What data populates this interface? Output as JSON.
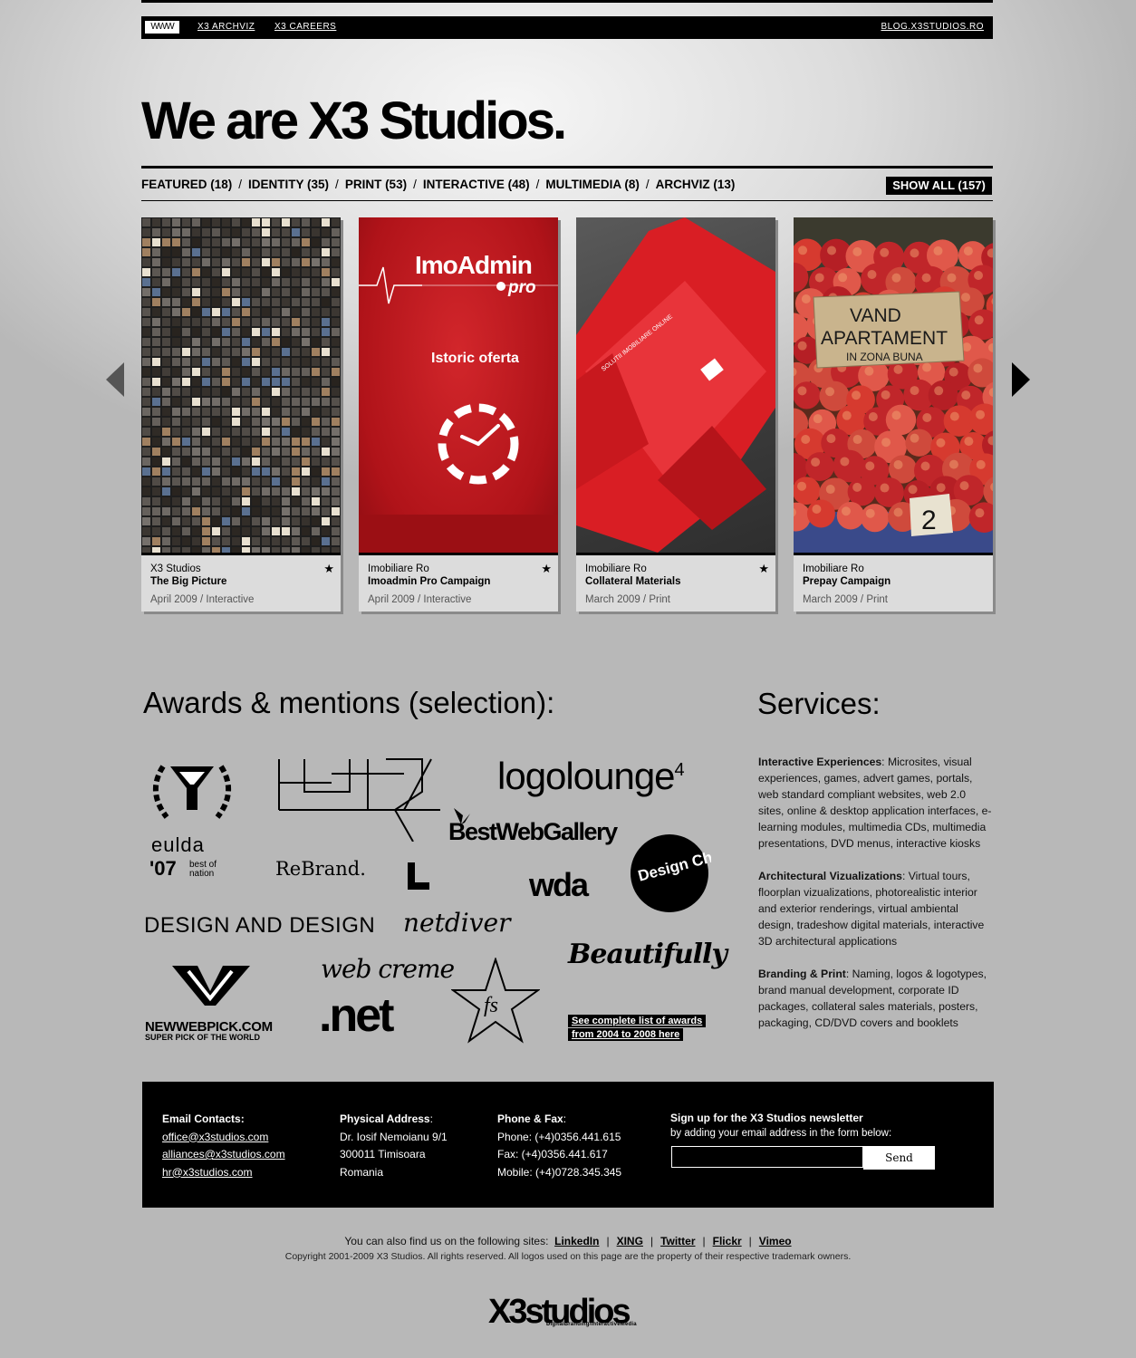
{
  "topnav": {
    "logo": "WWW",
    "archviz": "X3 ARCHVIZ",
    "careers": "X3 CAREERS",
    "blog": "BLOG.X3STUDIOS.RO"
  },
  "hero_title": "We are X3 Studios.",
  "filters": [
    {
      "label": "FEATURED (18)"
    },
    {
      "label": "IDENTITY (35)"
    },
    {
      "label": "PRINT (53)"
    },
    {
      "label": "INTERACTIVE (48)"
    },
    {
      "label": "MULTIMEDIA (8)"
    },
    {
      "label": "ARCHVIZ (13)"
    }
  ],
  "filter_separator": "/",
  "show_all": "SHOW ALL (157)",
  "portfolio": [
    {
      "client": "X3 Studios",
      "title": "The Big Picture",
      "date": "April 2009",
      "category": "Interactive",
      "featured": true
    },
    {
      "client": "Imobiliare Ro",
      "title": "Imoadmin Pro Campaign",
      "date": "April 2009",
      "category": "Interactive",
      "featured": true
    },
    {
      "client": "Imobiliare Ro",
      "title": "Collateral Materials",
      "date": "March 2009",
      "category": "Print",
      "featured": true
    },
    {
      "client": "Imobiliare Ro",
      "title": "Prepay Campaign",
      "date": "March 2009",
      "category": "Print",
      "featured": false
    }
  ],
  "card_art": {
    "imoadmin_brand": "ImoAdmin",
    "imoadmin_pro": "pro",
    "imoadmin_tagline": "Istoric oferta",
    "folder_text": "SOLUTII IMOBILIARE ONLINE",
    "sign_line1": "VAND",
    "sign_line2": "APARTAMENT",
    "sign_line3": "IN ZONA BUNA",
    "price_tag": "2"
  },
  "star_glyph": "★",
  "awards": {
    "heading": "Awards & mentions (selection):",
    "logos": {
      "eulda": "eulda",
      "eulda_year": "'07",
      "eulda_best": "best of",
      "eulda_nation": "nation",
      "logolounge": "logolounge",
      "logolounge_sup": "4",
      "bestwebgallery": "BestWebGallery",
      "rebrand": "ReBrand.",
      "wda": "wda",
      "design_charts": "Design Charts",
      "design_and_design": "DESIGN AND DESIGN",
      "netdiver": "netdiver",
      "beautifully": "Beautifully",
      "newwebpick": "NEWWEBPICK.COM",
      "newwebpick_sub": "SUPER PICK OF THE WORLD",
      "webcreme": "web creme",
      "dotnet": ".net",
      "fs": "fs"
    },
    "see_all_line1": "See complete list of awards",
    "see_all_line2": "from 2004 to 2008 here"
  },
  "services": {
    "heading": "Services:",
    "items": [
      {
        "title": "Interactive Experiences",
        "text": ": Microsites, visual experiences, games, advert games, portals, web standard compliant websites, web 2.0 sites, online & desktop application interfaces, e-learning modules, multimedia CDs, multimedia presentations, DVD menus, interactive kiosks"
      },
      {
        "title": "Architectural Vizualizations",
        "text": ": Virtual tours, floorplan vizualizations, photorealistic interior and exterior renderings, virtual ambiental design, tradeshow digital materials, interactive 3D architectural applications"
      },
      {
        "title": "Branding & Print",
        "text": ": Naming, logos & logotypes, brand manual development, corporate ID packages, collateral sales materials, posters, packaging, CD/DVD covers and booklets"
      }
    ]
  },
  "footer": {
    "email": {
      "heading": "Email Contacts:",
      "items": [
        "office@x3studios.com",
        "alliances@x3studios.com",
        "hr@x3studios.com"
      ]
    },
    "address": {
      "heading": "Physical Address",
      "colon": ":",
      "lines": [
        "Dr. Iosif Nemoianu 9/1",
        "300011 Timisoara",
        "Romania"
      ]
    },
    "phone": {
      "heading": "Phone & Fax",
      "colon": ":",
      "lines": [
        "Phone: (+4)0356.441.615",
        "Fax: (+4)0356.441.617",
        "Mobile: (+4)0728.345.345"
      ]
    },
    "newsletter": {
      "heading": "Sign up for the X3 Studios newsletter",
      "subtext": "by adding your email address in the form below:",
      "input_value": "",
      "send": "Send"
    }
  },
  "social": {
    "intro": "You can also find us on the following sites:",
    "links": [
      "LinkedIn",
      "XING",
      "Twitter",
      "Flickr",
      "Vimeo"
    ],
    "separator": "|"
  },
  "copyright": "Copyright 2001-2009 X3 Studios. All rights reserved. All logos used on this page are the property of their respective trademark owners.",
  "footer_logo": "X3studios",
  "footer_logo_sub": "DigitalBranding/InteractiveMedia",
  "colors": {
    "accent_red": "#c4161c",
    "black": "#000000",
    "background": "#b8b8b8"
  }
}
